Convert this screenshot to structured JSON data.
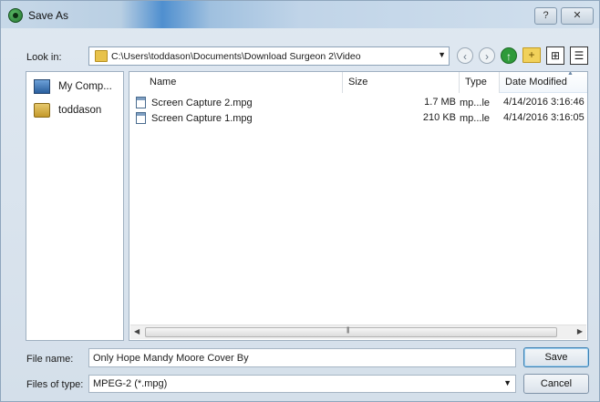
{
  "window": {
    "title": "Save As",
    "help_label": "?",
    "close_label": "✕"
  },
  "lookin": {
    "label": "Look in:",
    "path": "C:\\Users\\toddason\\Documents\\Download Surgeon 2\\Video"
  },
  "places": [
    {
      "label": "My Comp...",
      "icon": "computer-icon"
    },
    {
      "label": "toddason",
      "icon": "user-folder-icon"
    }
  ],
  "columns": {
    "name": "Name",
    "size": "Size",
    "type": "Type",
    "date": "Date Modified"
  },
  "files": [
    {
      "name": "Screen Capture 2.mpg",
      "size": "1.7 MB",
      "type": "mp...le",
      "date": "4/14/2016 3:16:46"
    },
    {
      "name": "Screen Capture 1.mpg",
      "size": "210 KB",
      "type": "mp...le",
      "date": "4/14/2016 3:16:05"
    }
  ],
  "filename": {
    "label": "File name:",
    "value": "Only Hope Mandy Moore Cover By"
  },
  "filetype": {
    "label": "Files of type:",
    "value": "MPEG-2 (*.mpg)"
  },
  "buttons": {
    "save": "Save",
    "cancel": "Cancel"
  },
  "colors": {
    "accent": "#3c7fb1",
    "titlebar": "#4f8fcf"
  }
}
